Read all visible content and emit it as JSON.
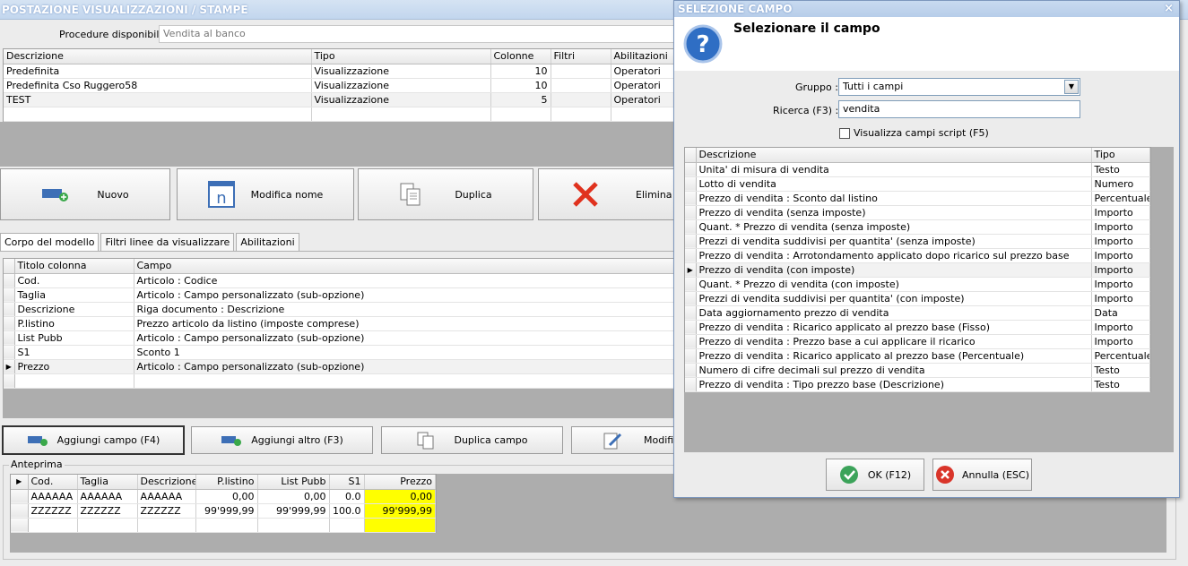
{
  "main": {
    "title": "POSTAZIONE VISUALIZZAZIONI / STAMPE",
    "procedure_label": "Procedure disponibili :",
    "procedure_value": "Vendita al banco",
    "models": {
      "headers": [
        "Descrizione",
        "Tipo",
        "Colonne",
        "Filtri",
        "Abilitazioni"
      ],
      "rows": [
        [
          "Predefinita",
          "Visualizzazione",
          "10",
          "",
          "Operatori"
        ],
        [
          "Predefinita Cso Ruggero58",
          "Visualizzazione",
          "10",
          "",
          "Operatori"
        ],
        [
          "TEST",
          "Visualizzazione",
          "5",
          "",
          "Operatori"
        ]
      ]
    },
    "toolbar": {
      "new": "Nuovo",
      "rename": "Modifica nome",
      "duplicate": "Duplica",
      "delete": "Elimina"
    },
    "tabs": [
      "Corpo del modello",
      "Filtri linee da visualizzare",
      "Abilitazioni"
    ],
    "columns": {
      "headers": [
        "Titolo colonna",
        "Campo"
      ],
      "rows": [
        [
          "Cod.",
          "Articolo : Codice"
        ],
        [
          "Taglia",
          "Articolo : Campo personalizzato (sub-opzione)"
        ],
        [
          "Descrizione",
          "Riga documento : Descrizione"
        ],
        [
          "P.listino",
          "Prezzo articolo da listino (imposte comprese)"
        ],
        [
          "List Pubb",
          "Articolo : Campo personalizzato (sub-opzione)"
        ],
        [
          "S1",
          "Sconto 1"
        ],
        [
          "Prezzo",
          "Articolo : Campo personalizzato (sub-opzione)"
        ]
      ]
    },
    "field_buttons": {
      "add_field": "Aggiungi campo (F4)",
      "add_other": "Aggiungi altro (F3)",
      "dup_field": "Duplica campo",
      "modify": "Modifi"
    },
    "preview": {
      "label": "Anteprima",
      "headers": [
        "Cod.",
        "Taglia",
        "Descrizione",
        "P.listino",
        "List Pubb",
        "S1",
        "Prezzo"
      ],
      "rows": [
        [
          "AAAAAA",
          "AAAAAA",
          "AAAAAA",
          "0,00",
          "0,00",
          "0.0",
          "0,00"
        ],
        [
          "ZZZZZZ",
          "ZZZZZZ",
          "ZZZZZZ",
          "99'999,99",
          "99'999,99",
          "100.0",
          "99'999,99"
        ]
      ],
      "highlight_color": "#ffff00"
    }
  },
  "dialog": {
    "title": "SELEZIONE CAMPO",
    "close": "×",
    "heading": "Selezionare il campo",
    "group_label": "Gruppo :",
    "group_value": "Tutti i campi",
    "search_label": "Ricerca (F3) :",
    "search_value": "vendita",
    "script_checkbox": "Visualizza campi script (F5)",
    "fields": {
      "headers": [
        "Descrizione",
        "Tipo"
      ],
      "rows": [
        [
          "Unita' di misura di vendita",
          "Testo"
        ],
        [
          "Lotto di vendita",
          "Numero"
        ],
        [
          "Prezzo di vendita : Sconto dal listino",
          "Percentuale"
        ],
        [
          "Prezzo di vendita (senza imposte)",
          "Importo"
        ],
        [
          "Quant. * Prezzo di vendita (senza imposte)",
          "Importo"
        ],
        [
          "Prezzi di vendita suddivisi per quantita' (senza imposte)",
          "Importo"
        ],
        [
          "Prezzo di vendita : Arrotondamento applicato dopo ricarico sul prezzo base",
          "Importo"
        ],
        [
          "Prezzo di vendita (con imposte)",
          "Importo"
        ],
        [
          "Quant. * Prezzo di vendita (con imposte)",
          "Importo"
        ],
        [
          "Prezzi di vendita suddivisi per quantita' (con imposte)",
          "Importo"
        ],
        [
          "Data aggiornamento prezzo di vendita",
          "Data"
        ],
        [
          "Prezzo di vendita : Ricarico applicato al prezzo base (Fisso)",
          "Importo"
        ],
        [
          "Prezzo di vendita : Prezzo base a cui applicare il ricarico",
          "Importo"
        ],
        [
          "Prezzo di vendita : Ricarico applicato al prezzo base (Percentuale)",
          "Percentuale"
        ],
        [
          "Numero di cifre decimali sul prezzo di vendita",
          "Testo"
        ],
        [
          "Prezzo di vendita : Tipo prezzo base (Descrizione)",
          "Testo"
        ]
      ]
    },
    "ok": "OK (F12)",
    "cancel": "Annulla (ESC)"
  }
}
